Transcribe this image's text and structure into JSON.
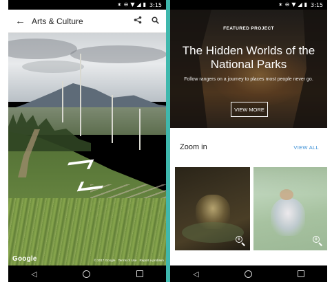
{
  "status": {
    "time": "3:15",
    "icons": [
      "bluetooth-icon",
      "do-not-disturb-icon",
      "wifi-icon",
      "signal-icon",
      "battery-icon"
    ]
  },
  "left_app": {
    "title": "Arts & Culture",
    "watermark": "Google",
    "legal": [
      "© 2017 Google",
      "Terms of Use",
      "Report a problem"
    ]
  },
  "right_app": {
    "featured": {
      "label": "FEATURED PROJECT",
      "title": "The Hidden Worlds of the National Parks",
      "subtitle": "Follow rangers on a journey to places most people never go.",
      "button": "VIEW MORE"
    },
    "zoom_section": {
      "title": "Zoom in",
      "view_all": "VIEW ALL"
    }
  },
  "nav": {
    "glyphs": {
      "back": "◁"
    }
  },
  "colors": {
    "divider": "#3fb8ad",
    "link": "#3a8fd6",
    "statusbar": "#000000"
  }
}
